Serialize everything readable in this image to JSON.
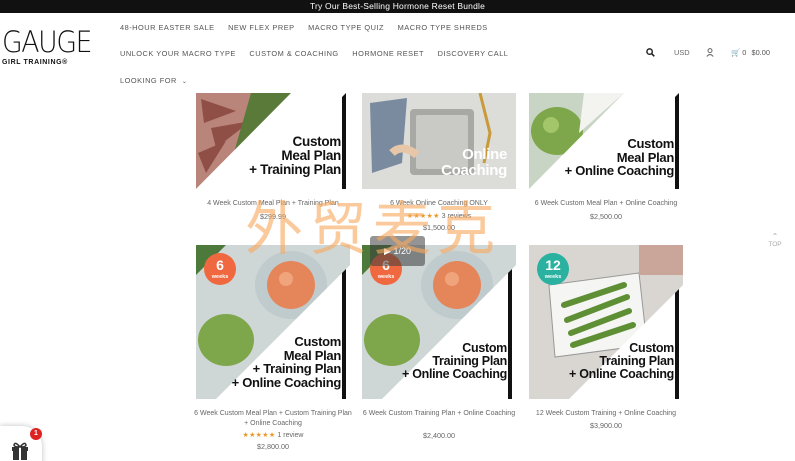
{
  "announcement": "Try Our Best-Selling Hormone Reset Bundle",
  "logo": {
    "wordmark": "GAUGE",
    "tagline": "GIRL TRAINING®"
  },
  "nav": {
    "row1": [
      "48-HOUR EASTER SALE",
      "NEW FLEX PREP",
      "MACRO TYPE QUIZ",
      "MACRO TYPE SHREDS"
    ],
    "row2": [
      "UNLOCK YOUR MACRO TYPE",
      "CUSTOM & COACHING",
      "HORMONE RESET",
      "DISCOVERY CALL"
    ],
    "looking_for": "LOOKING FOR"
  },
  "utility": {
    "search_icon": "search-icon",
    "currency": "USD",
    "user_icon": "user-icon",
    "cart_count": "0",
    "cart_total": "$0.00"
  },
  "products": [
    {
      "title_lines": [
        "Custom",
        "Meal Plan",
        "+ Training Plan"
      ],
      "name": "4 Week Custom Meal Plan + Training Plan",
      "price": "$299.99"
    },
    {
      "title_lines": [
        "Online",
        "Coaching"
      ],
      "name": "6 Week Online Coaching ONLY",
      "rating_stars": "★★★★★",
      "rating_text": "3 reviews",
      "price": "$1,500.00"
    },
    {
      "title_lines": [
        "Custom",
        "Meal Plan",
        "+ Online Coaching"
      ],
      "name": "6 Week Custom Meal Plan + Online Coaching",
      "price": "$2,500.00"
    },
    {
      "badge_number": "6",
      "badge_unit": "weeks",
      "title_lines": [
        "Custom",
        "Meal Plan",
        "+ Training Plan",
        "+ Online Coaching"
      ],
      "name": "6 Week Custom Meal Plan + Custom Training Plan + Online Coaching",
      "rating_stars": "★★★★★",
      "rating_text": "1 review",
      "price": "$2,800.00"
    },
    {
      "badge_number": "6",
      "badge_unit": "weeks",
      "title_lines": [
        "Custom",
        "Training Plan",
        "+ Online Coaching"
      ],
      "name": "6 Week Custom Training Plan + Online Coaching",
      "price": "$2,400.00"
    },
    {
      "badge_number": "12",
      "badge_unit": "weeks",
      "title_lines": [
        "Custom",
        "Training Plan",
        "+ Online Coaching"
      ],
      "name": "12 Week Custom Training + Online Coaching",
      "price": "$3,900.00"
    }
  ],
  "back_to_top": "TOP",
  "gift_count": "1",
  "watermark": "外贸麦克",
  "colors": {
    "badge_orange": "#f0683f",
    "badge_teal": "#2bb1a0",
    "star": "#e99a2a"
  }
}
